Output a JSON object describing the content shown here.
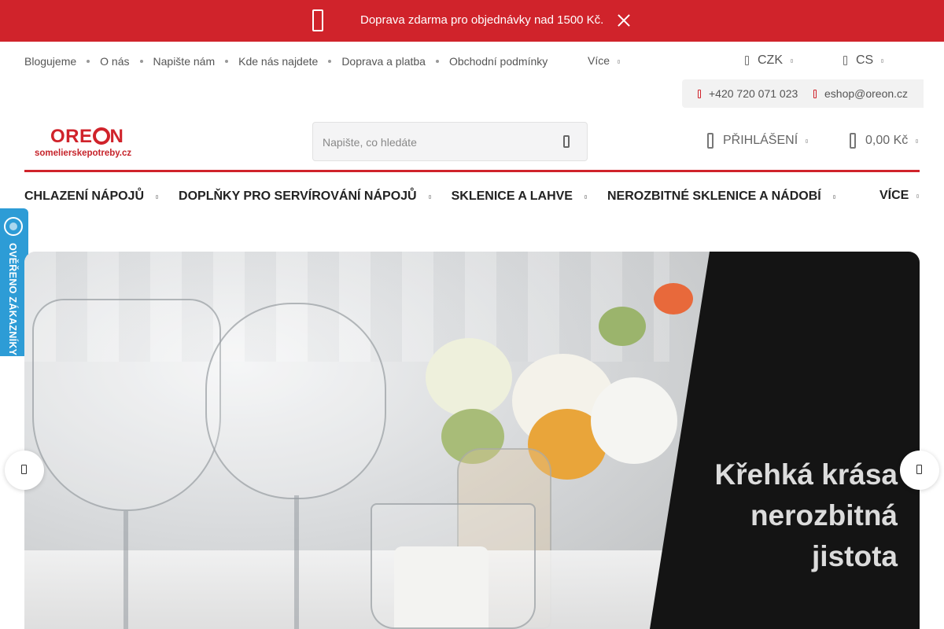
{
  "promo": {
    "message": "Doprava zdarma pro objednávky nad 1500 Kč."
  },
  "toplinks": {
    "items": [
      "Blogujeme",
      "O nás",
      "Napište nám",
      "Kde nás najdete",
      "Doprava a platba",
      "Obchodní podmínky"
    ],
    "more": "Více"
  },
  "currency": "CZK",
  "language": "CS",
  "contact": {
    "phone": "+420 720 071 023",
    "email": "eshop@oreon.cz"
  },
  "logo": {
    "brand": "ORE N",
    "sub": "somelierskepotreby.cz"
  },
  "search": {
    "placeholder": "Napište, co hledáte"
  },
  "account": {
    "login": "PŘIHLÁŠENÍ"
  },
  "cart": {
    "total": "0,00 Kč"
  },
  "mainnav": {
    "items": [
      "CHLAZENÍ NÁPOJŮ",
      "DOPLŇKY PRO SERVÍROVÁNÍ NÁPOJŮ",
      "SKLENICE A LAHVE",
      "NEROZBITNÉ SKLENICE A NÁDOBÍ"
    ],
    "more": "VÍCE"
  },
  "badge": {
    "label": "OVĚŘENO ZÁKAZNÍKY"
  },
  "hero": {
    "lines": [
      "Křehká krása",
      "nerozbitná",
      "jistota"
    ]
  },
  "colors": {
    "brand_red": "#d0232b",
    "badge_blue": "#2d9cd6",
    "hero_dark": "#141414"
  },
  "icons": [
    "truck-icon",
    "close-icon",
    "currency-icon",
    "language-icon",
    "phone-icon",
    "email-icon",
    "search-icon",
    "user-icon",
    "cart-icon",
    "chevron-left-icon",
    "chevron-right-icon"
  ]
}
